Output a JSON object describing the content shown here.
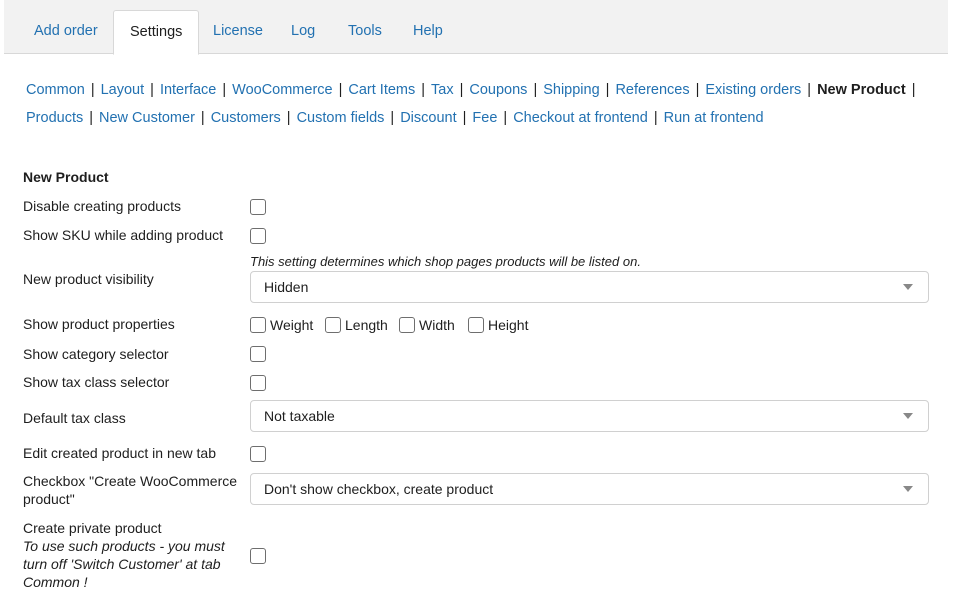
{
  "tabs": {
    "add_order": "Add order",
    "settings": "Settings",
    "license": "License",
    "log": "Log",
    "tools": "Tools",
    "help": "Help"
  },
  "subnav": {
    "common": "Common",
    "layout": "Layout",
    "interface": "Interface",
    "woocommerce": "WooCommerce",
    "cart_items": "Cart Items",
    "tax": "Tax",
    "coupons": "Coupons",
    "shipping": "Shipping",
    "references": "References",
    "existing_orders": "Existing orders",
    "new_product": "New Product",
    "products": "Products",
    "new_customer": "New Customer",
    "customers": "Customers",
    "custom_fields": "Custom fields",
    "discount": "Discount",
    "fee": "Fee",
    "checkout_at_frontend": "Checkout at frontend",
    "run_at_frontend": "Run at frontend",
    "separator": "|"
  },
  "section": {
    "title": "New Product"
  },
  "settings": {
    "disable_creating": {
      "label": "Disable creating products",
      "checked": false
    },
    "show_sku": {
      "label": "Show SKU while adding product",
      "checked": false
    },
    "visibility": {
      "label": "New product visibility",
      "hint": "This setting determines which shop pages products will be listed on.",
      "value": "Hidden"
    },
    "properties": {
      "label": "Show product properties",
      "weight": "Weight",
      "length": "Length",
      "width": "Width",
      "height": "Height"
    },
    "category_selector": {
      "label": "Show category selector",
      "checked": false
    },
    "tax_class_selector": {
      "label": "Show tax class selector",
      "checked": false
    },
    "default_tax_class": {
      "label": "Default tax class",
      "value": "Not taxable"
    },
    "edit_new_tab": {
      "label": "Edit created product in new tab",
      "checked": false
    },
    "create_wc_checkbox": {
      "label_line1": "Checkbox \"Create WooCommerce",
      "label_line2": "product\"",
      "value": "Don't show checkbox, create product"
    },
    "private_product": {
      "label": "Create private product",
      "note_line1": "To use such products - you must",
      "note_line2": "turn off 'Switch Customer' at tab",
      "note_line3": "Common !",
      "checked": false
    }
  }
}
